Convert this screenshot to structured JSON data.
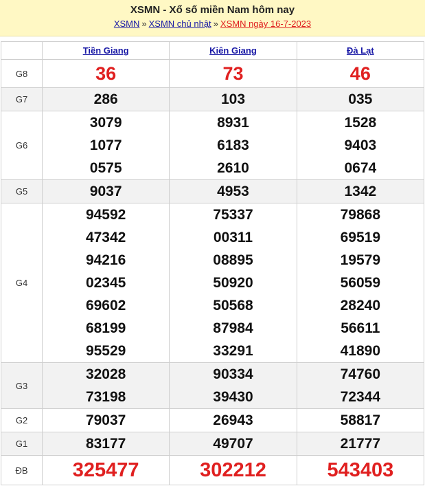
{
  "header": {
    "title": "XSMN - Xổ số miền Nam hôm nay",
    "breadcrumb": [
      "XSMN",
      "XSMN chủ nhật",
      "XSMN ngày 16-7-2023"
    ],
    "separator": "»"
  },
  "provinces": [
    "Tiền Giang",
    "Kiên Giang",
    "Đà Lạt"
  ],
  "prizes": {
    "G8": {
      "label": "G8",
      "values": [
        [
          "36"
        ],
        [
          "73"
        ],
        [
          "46"
        ]
      ]
    },
    "G7": {
      "label": "G7",
      "values": [
        [
          "286"
        ],
        [
          "103"
        ],
        [
          "035"
        ]
      ]
    },
    "G6": {
      "label": "G6",
      "values": [
        [
          "3079",
          "1077",
          "0575"
        ],
        [
          "8931",
          "6183",
          "2610"
        ],
        [
          "1528",
          "9403",
          "0674"
        ]
      ]
    },
    "G5": {
      "label": "G5",
      "values": [
        [
          "9037"
        ],
        [
          "4953"
        ],
        [
          "1342"
        ]
      ]
    },
    "G4": {
      "label": "G4",
      "values": [
        [
          "94592",
          "47342",
          "94216",
          "02345",
          "69602",
          "68199",
          "95529"
        ],
        [
          "75337",
          "00311",
          "08895",
          "50920",
          "50568",
          "87984",
          "33291"
        ],
        [
          "79868",
          "69519",
          "19579",
          "56059",
          "28240",
          "56611",
          "41890"
        ]
      ]
    },
    "G3": {
      "label": "G3",
      "values": [
        [
          "32028",
          "73198"
        ],
        [
          "90334",
          "39430"
        ],
        [
          "74760",
          "72344"
        ]
      ]
    },
    "G2": {
      "label": "G2",
      "values": [
        [
          "79037"
        ],
        [
          "26943"
        ],
        [
          "58817"
        ]
      ]
    },
    "G1": {
      "label": "G1",
      "values": [
        [
          "83177"
        ],
        [
          "49707"
        ],
        [
          "21777"
        ]
      ]
    },
    "DB": {
      "label": "ĐB",
      "values": [
        [
          "325477"
        ],
        [
          "302212"
        ],
        [
          "543403"
        ]
      ]
    }
  },
  "colors": {
    "header_bg": "#fff8c4",
    "accent_red": "#e02020",
    "link_blue": "#1a1aa6",
    "row_grey": "#f2f2f2"
  }
}
